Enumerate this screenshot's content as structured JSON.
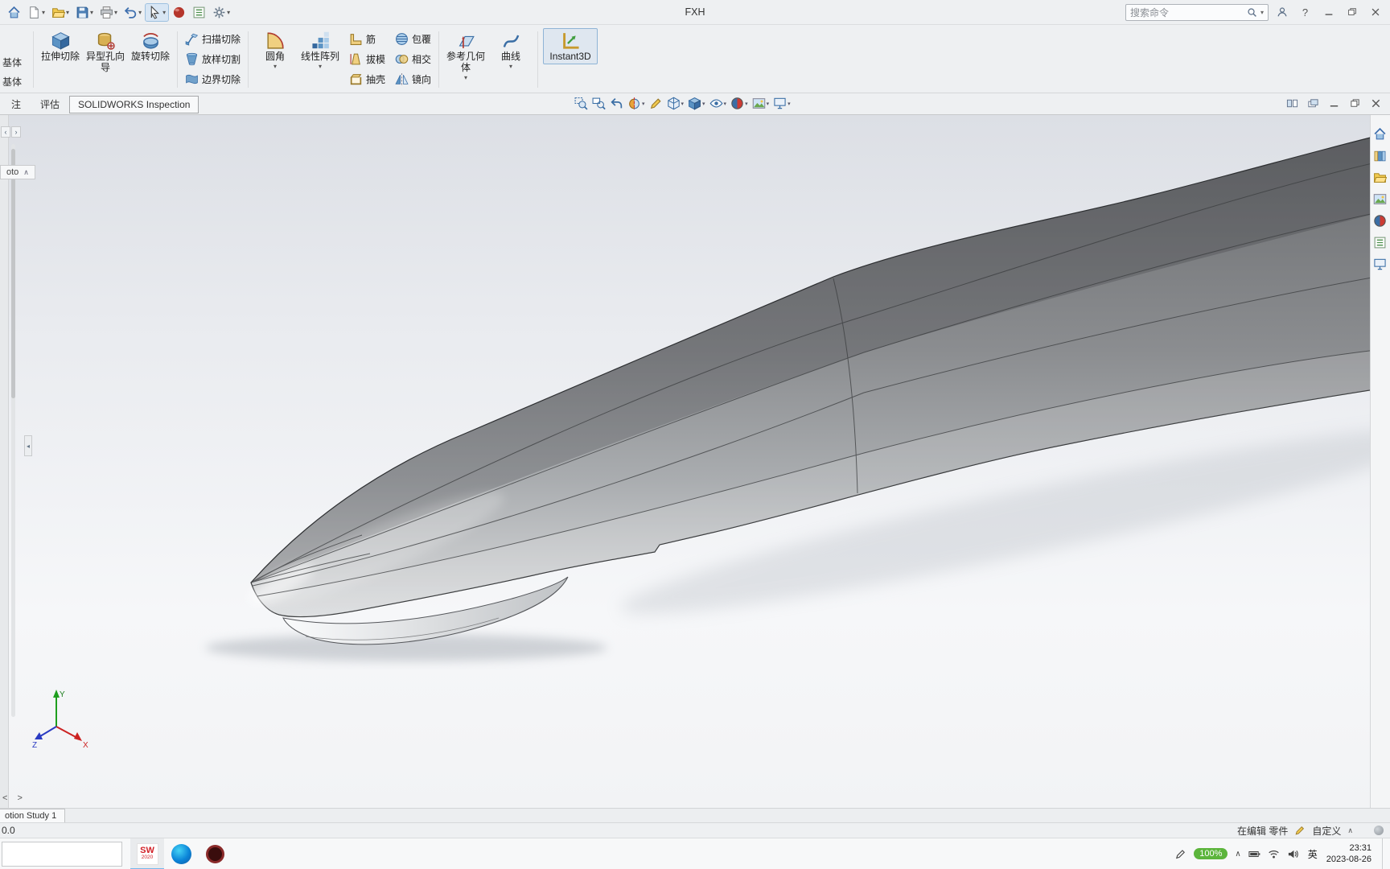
{
  "titlebar": {
    "title": "FXH",
    "search_placeholder": "搜索命令",
    "quick_access": [
      {
        "name": "home-icon",
        "icon": "home"
      },
      {
        "name": "new-icon",
        "icon": "new",
        "caret": true
      },
      {
        "name": "open-icon",
        "icon": "open",
        "caret": true
      },
      {
        "name": "save-icon",
        "icon": "save",
        "caret": true
      },
      {
        "name": "print-icon",
        "icon": "print",
        "caret": true
      },
      {
        "name": "undo-icon",
        "icon": "undo",
        "caret": true
      },
      {
        "name": "select-icon",
        "icon": "select",
        "caret": true,
        "active": true
      },
      {
        "name": "performance-icon",
        "icon": "performance"
      },
      {
        "name": "list-icon",
        "icon": "list"
      },
      {
        "name": "options-icon",
        "icon": "gear",
        "caret": true
      }
    ]
  },
  "ribbon": {
    "clipped_labels": [
      "基体",
      "基体"
    ],
    "group1": [
      {
        "name": "extruded-cut-button",
        "label": "拉伸切除",
        "icon": "cube-blue"
      },
      {
        "name": "hole-wizard-button",
        "label": "异型孔向导",
        "icon": "hole-wizard"
      },
      {
        "name": "revolved-cut-button",
        "label": "旋转切除",
        "icon": "revolve-cut"
      }
    ],
    "group2": [
      {
        "name": "swept-cut-button",
        "label": "扫描切除",
        "icon": "sweep-cut"
      },
      {
        "name": "lofted-cut-button",
        "label": "放样切割",
        "icon": "loft-cut"
      },
      {
        "name": "boundary-cut-button",
        "label": "边界切除",
        "icon": "boundary-cut"
      }
    ],
    "group3": [
      {
        "name": "fillet-button",
        "label": "圆角",
        "icon": "fillet",
        "caret": true
      },
      {
        "name": "linear-pattern-button",
        "label": "线性阵列",
        "icon": "pattern",
        "caret": true
      }
    ],
    "group4": [
      {
        "name": "rib-button",
        "label": "筋",
        "icon": "rib"
      },
      {
        "name": "draft-button",
        "label": "拔模",
        "icon": "draft"
      },
      {
        "name": "shell-button",
        "label": "抽壳",
        "icon": "shell"
      }
    ],
    "group5": [
      {
        "name": "wrap-button",
        "label": "包覆",
        "icon": "wrap"
      },
      {
        "name": "intersect-button",
        "label": "相交",
        "icon": "intersect"
      },
      {
        "name": "mirror-button",
        "label": "镜向",
        "icon": "mirror"
      }
    ],
    "group6": [
      {
        "name": "reference-geometry-button",
        "label": "参考几何体",
        "icon": "ref-geometry",
        "caret": true
      },
      {
        "name": "curves-button",
        "label": "曲线",
        "icon": "curve",
        "caret": true
      }
    ],
    "group7": [
      {
        "name": "instant3d-button",
        "label": "Instant3D",
        "icon": "instant3d",
        "active": true
      }
    ]
  },
  "tabs": [
    {
      "name": "tab-fragment",
      "label": "注"
    },
    {
      "name": "tab-evaluate",
      "label": "评估"
    },
    {
      "name": "tab-solidworks-inspection",
      "label": "SOLIDWORKS Inspection",
      "boxed": true
    }
  ],
  "headsup": [
    {
      "name": "zoom-fit-icon",
      "icon": "zoom-fit"
    },
    {
      "name": "zoom-area-icon",
      "icon": "zoom-area"
    },
    {
      "name": "previous-view-icon",
      "icon": "previous-view"
    },
    {
      "name": "section-view-icon",
      "icon": "section-view",
      "caret": true
    },
    {
      "name": "annotation-views-icon",
      "icon": "dynamic-annotation"
    },
    {
      "name": "view-orientation-icon",
      "icon": "view-orientation",
      "caret": true
    },
    {
      "name": "display-style-icon",
      "icon": "display-style",
      "caret": true
    },
    {
      "name": "hide-show-items-icon",
      "icon": "hide-show-items",
      "caret": true
    },
    {
      "name": "edit-appearance-icon",
      "icon": "edit-appearance",
      "caret": true
    },
    {
      "name": "apply-scene-icon",
      "icon": "apply-scene",
      "caret": true
    },
    {
      "name": "view-settings-icon",
      "icon": "view-settings",
      "caret": true
    }
  ],
  "doc_controls": [
    {
      "name": "window-split-icon",
      "icon": "win-split"
    },
    {
      "name": "window-tabs-icon",
      "icon": "win-tabs"
    },
    {
      "name": "doc-minimize-icon",
      "icon": "win-min"
    },
    {
      "name": "doc-restore-icon",
      "icon": "win-restore"
    },
    {
      "name": "doc-close-icon",
      "icon": "win-close"
    }
  ],
  "taskpane": [
    {
      "name": "taskpane-home-icon",
      "icon": "home"
    },
    {
      "name": "design-library-icon",
      "icon": "design-library"
    },
    {
      "name": "file-explorer-icon",
      "icon": "open"
    },
    {
      "name": "view-palette-icon",
      "icon": "apply-scene"
    },
    {
      "name": "appearances-icon",
      "icon": "edit-appearance"
    },
    {
      "name": "custom-properties-icon",
      "icon": "list"
    },
    {
      "name": "forum-icon",
      "icon": "view-settings"
    }
  ],
  "viewport": {
    "flyout_text": "oto",
    "triad": {
      "x": "X",
      "y": "Y",
      "z": "Z"
    }
  },
  "motionbar": {
    "tab": "otion Study 1"
  },
  "statusbar": {
    "coordinate": "0.0",
    "editing_status": "在编辑 零件",
    "custom_label": "自定义"
  },
  "taskbar": {
    "apps": [
      {
        "name": "solidworks-app",
        "label": "SW",
        "sub": "2020"
      },
      {
        "name": "edge-app"
      },
      {
        "name": "recorder-app"
      }
    ],
    "tray": {
      "battery_percent": "100%",
      "ime": "英",
      "time": "23:31",
      "date": "2023-08-26"
    }
  }
}
